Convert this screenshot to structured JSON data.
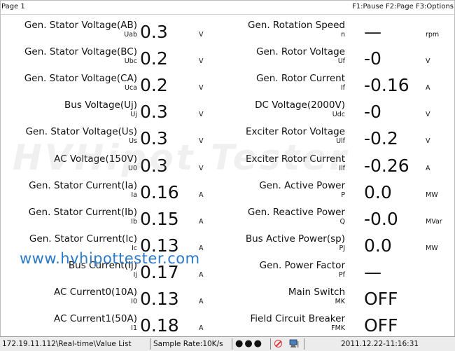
{
  "header": {
    "page": "Page 1",
    "function_keys": "F1:Pause F2:Page F3:Options"
  },
  "left_rows": [
    {
      "label": "Gen. Stator Voltage(AB)",
      "symbol": "Uab",
      "value": "0.3",
      "unit": "V"
    },
    {
      "label": "Gen. Stator Voltage(BC)",
      "symbol": "Ubc",
      "value": "0.2",
      "unit": "V"
    },
    {
      "label": "Gen. Stator Voltage(CA)",
      "symbol": "Uca",
      "value": "0.2",
      "unit": "V"
    },
    {
      "label": "Bus Voltage(Uj)",
      "symbol": "Uj",
      "value": "0.3",
      "unit": "V"
    },
    {
      "label": "Gen. Stator Voltage(Us)",
      "symbol": "Us",
      "value": "0.3",
      "unit": "V"
    },
    {
      "label": "AC Voltage(150V)",
      "symbol": "U0",
      "value": "0.3",
      "unit": "V"
    },
    {
      "label": "Gen. Stator Current(Ia)",
      "symbol": "Ia",
      "value": "0.16",
      "unit": "A"
    },
    {
      "label": "Gen. Stator Current(Ib)",
      "symbol": "Ib",
      "value": "0.15",
      "unit": "A"
    },
    {
      "label": "Gen. Stator Current(Ic)",
      "symbol": "Ic",
      "value": "0.13",
      "unit": "A"
    },
    {
      "label": "Bus Current(Ij)",
      "symbol": "Ij",
      "value": "0.17",
      "unit": "A"
    },
    {
      "label": "AC Current0(10A)",
      "symbol": "I0",
      "value": "0.13",
      "unit": "A"
    },
    {
      "label": "AC Current1(50A)",
      "symbol": "I1",
      "value": "0.18",
      "unit": "A"
    }
  ],
  "right_rows": [
    {
      "label": "Gen. Rotation Speed",
      "symbol": "n",
      "value": "—",
      "unit": "rpm"
    },
    {
      "label": "Gen. Rotor Voltage",
      "symbol": "Uf",
      "value": "-0",
      "unit": "V"
    },
    {
      "label": "Gen. Rotor Current",
      "symbol": "If",
      "value": "-0.16",
      "unit": "A"
    },
    {
      "label": "DC Voltage(2000V)",
      "symbol": "Udc",
      "value": "-0",
      "unit": "V"
    },
    {
      "label": "Exciter Rotor Voltage",
      "symbol": "Ulf",
      "value": "-0.2",
      "unit": "V"
    },
    {
      "label": "Exciter Rotor Current",
      "symbol": "Ilf",
      "value": "-0.26",
      "unit": "A"
    },
    {
      "label": "Gen. Active Power",
      "symbol": "P",
      "value": "0.0",
      "unit": "MW"
    },
    {
      "label": "Gen. Reactive Power",
      "symbol": "Q",
      "value": "-0.0",
      "unit": "MVar"
    },
    {
      "label": "Bus Active Power(sp)",
      "symbol": "PJ",
      "value": "0.0",
      "unit": "MW"
    },
    {
      "label": "Gen. Power Factor",
      "symbol": "Pf",
      "value": "—",
      "unit": ""
    },
    {
      "label": "Main Switch",
      "symbol": "MK",
      "value": "OFF",
      "unit": ""
    },
    {
      "label": "Field Circuit Breaker",
      "symbol": "FMK",
      "value": "OFF",
      "unit": ""
    }
  ],
  "overlay": {
    "watermark": "HVHipot Tester",
    "url": "www.hvhipottester.com"
  },
  "status_bar": {
    "path": "172.19.11.112\\Real-time\\Value List",
    "sample_rate": "Sample Rate:10K/s",
    "indicators": "●●●",
    "datetime": "2011.12.22-11:16:31"
  },
  "icons": [
    "no-entry-icon",
    "computer-icon"
  ],
  "colors": {
    "url_text": "#2a78c8",
    "no_entry": "#dd3333"
  }
}
